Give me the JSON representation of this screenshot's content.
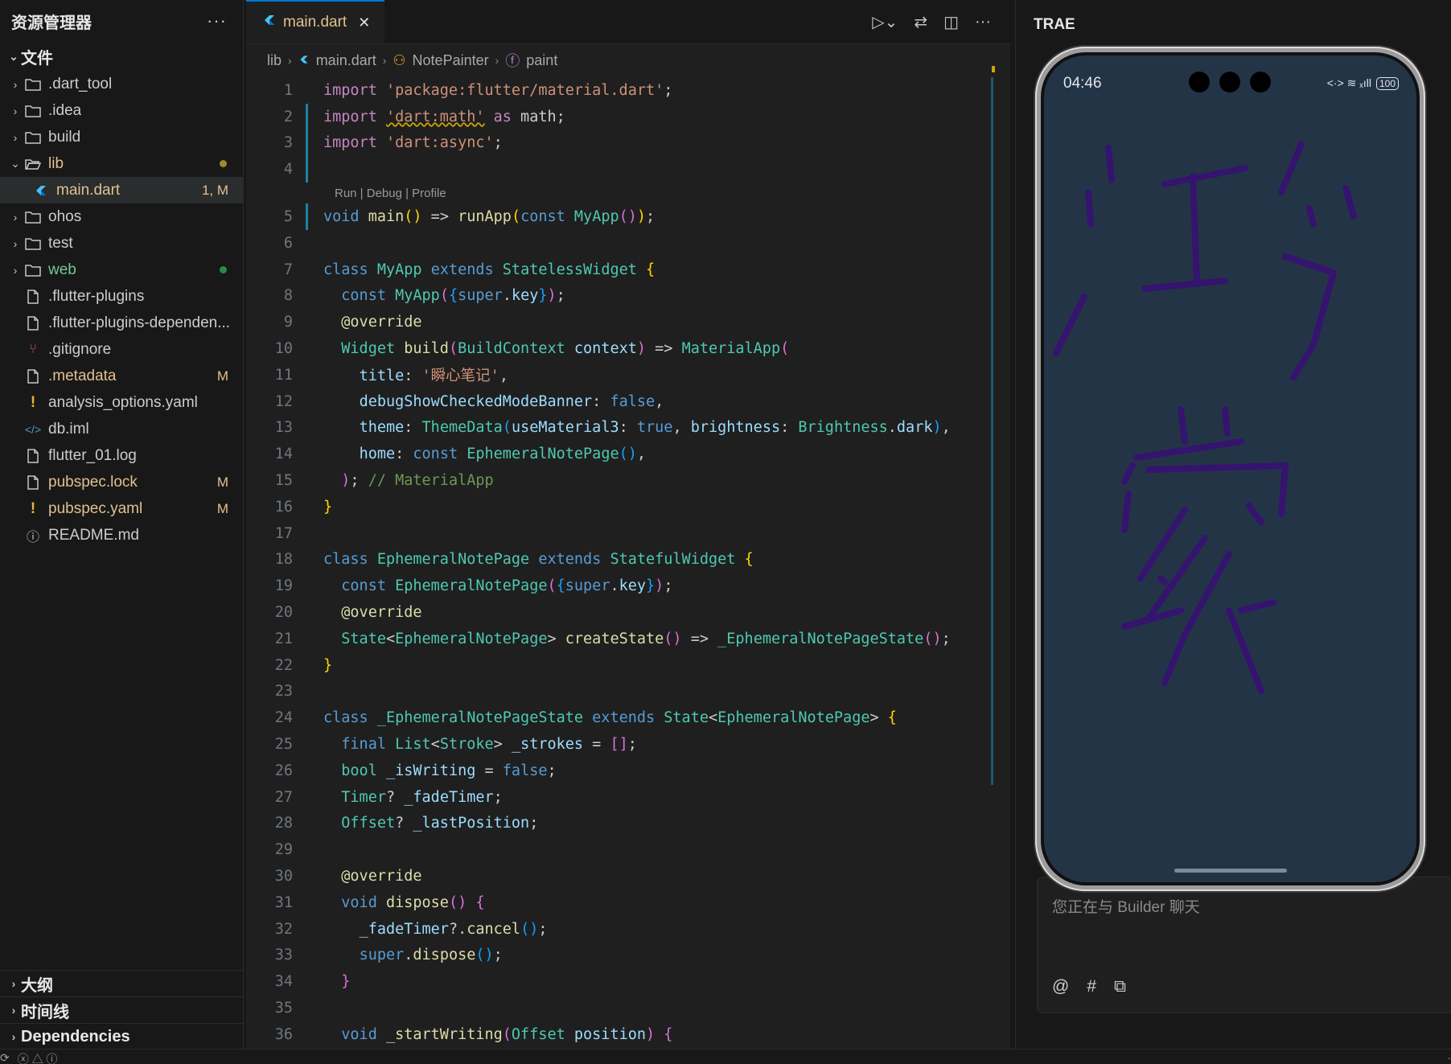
{
  "explorer": {
    "title": "资源管理器",
    "more": "···",
    "section": "文件",
    "items": [
      {
        "label": ".dart_tool",
        "kind": "folder",
        "open": false,
        "color": "#cccccc",
        "badge": "",
        "dot": ""
      },
      {
        "label": ".idea",
        "kind": "folder",
        "open": false,
        "color": "#cccccc",
        "badge": "",
        "dot": ""
      },
      {
        "label": "build",
        "kind": "folder",
        "open": false,
        "color": "#cccccc",
        "badge": "",
        "dot": ""
      },
      {
        "label": "lib",
        "kind": "folder",
        "open": true,
        "color": "#e2c08d",
        "badge": "",
        "dot": "#9b8b2b"
      },
      {
        "label": "main.dart",
        "kind": "dart",
        "open": false,
        "color": "#e2c08d",
        "badge": "1, M",
        "badge_color": "#e2c08d",
        "dot": "",
        "child": true,
        "selected": true
      },
      {
        "label": "ohos",
        "kind": "folder",
        "open": false,
        "color": "#cccccc",
        "badge": "",
        "dot": ""
      },
      {
        "label": "test",
        "kind": "folder",
        "open": false,
        "color": "#cccccc",
        "badge": "",
        "dot": ""
      },
      {
        "label": "web",
        "kind": "folder",
        "open": false,
        "color": "#73c991",
        "badge": "",
        "dot": "#2b8a4a"
      },
      {
        "label": ".flutter-plugins",
        "kind": "file",
        "color": "#cccccc",
        "badge": "",
        "dot": ""
      },
      {
        "label": ".flutter-plugins-dependen...",
        "kind": "file",
        "color": "#cccccc",
        "badge": "",
        "dot": ""
      },
      {
        "label": ".gitignore",
        "kind": "git",
        "color": "#cccccc",
        "badge": "",
        "dot": ""
      },
      {
        "label": ".metadata",
        "kind": "file",
        "color": "#e2c08d",
        "badge": "M",
        "badge_color": "#e2c08d",
        "dot": ""
      },
      {
        "label": "analysis_options.yaml",
        "kind": "yaml",
        "color": "#cccccc",
        "badge": "",
        "dot": ""
      },
      {
        "label": "db.iml",
        "kind": "xml",
        "color": "#cccccc",
        "badge": "",
        "dot": ""
      },
      {
        "label": "flutter_01.log",
        "kind": "file",
        "color": "#cccccc",
        "badge": "",
        "dot": ""
      },
      {
        "label": "pubspec.lock",
        "kind": "file",
        "color": "#e2c08d",
        "badge": "M",
        "badge_color": "#e2c08d",
        "dot": ""
      },
      {
        "label": "pubspec.yaml",
        "kind": "yaml",
        "color": "#e2c08d",
        "badge": "M",
        "badge_color": "#e2c08d",
        "dot": ""
      },
      {
        "label": "README.md",
        "kind": "info",
        "color": "#cccccc",
        "badge": "",
        "dot": ""
      }
    ],
    "bottom_sections": [
      "大纲",
      "时间线",
      "Dependencies"
    ]
  },
  "editor": {
    "tab_label": "main.dart",
    "breadcrumb": [
      "lib",
      "main.dart",
      "NotePainter",
      "paint"
    ],
    "codelens": "Run | Debug | Profile",
    "lines": [
      {
        "n": "1",
        "html": "<span class='k'>import</span> <span class='s'>'package:flutter/material.dart'</span>;"
      },
      {
        "n": "2",
        "html": "<span class='k'>import</span> <span class='s' style='text-decoration:underline wavy #cca700'>'dart:math'</span> <span class='k'>as</span> math;"
      },
      {
        "n": "3",
        "html": "<span class='k'>import</span> <span class='s'>'dart:async'</span>;"
      },
      {
        "n": "4",
        "html": ""
      },
      {
        "n": "5",
        "html": "<span class='kw'>void</span> <span class='fn'>main</span><span class='b1'>()</span> => <span class='fn'>runApp</span><span class='b1'>(</span><span class='kw'>const</span> <span class='ty'>MyApp</span><span class='b2'>()</span><span class='b1'>)</span>;",
        "lens": true
      },
      {
        "n": "6",
        "html": ""
      },
      {
        "n": "7",
        "html": "<span class='kw'>class</span> <span class='ty'>MyApp</span> <span class='kw'>extends</span> <span class='ty'>StatelessWidget</span> <span class='b1'>{</span>"
      },
      {
        "n": "8",
        "html": "  <span class='kw'>const</span> <span class='ty'>MyApp</span><span class='b2'>(</span><span class='b3'>{</span><span class='kw'>super</span>.<span class='v'>key</span><span class='b3'>}</span><span class='b2'>)</span>;"
      },
      {
        "n": "9",
        "html": "  <span class='fn'>@override</span>"
      },
      {
        "n": "10",
        "html": "  <span class='ty'>Widget</span> <span class='fn'>build</span><span class='b2'>(</span><span class='ty'>BuildContext</span> <span class='v'>context</span><span class='b2'>)</span> => <span class='ty'>MaterialApp</span><span class='b2'>(</span>"
      },
      {
        "n": "11",
        "html": "    <span class='pr'>title</span>: <span class='s'>'瞬心笔记'</span>,"
      },
      {
        "n": "12",
        "html": "    <span class='pr'>debugShowCheckedModeBanner</span>: <span class='kw'>false</span>,"
      },
      {
        "n": "13",
        "html": "    <span class='pr'>theme</span>: <span class='ty'>ThemeData</span><span class='b3'>(</span><span class='pr'>useMaterial3</span>: <span class='kw'>true</span>, <span class='pr'>brightness</span>: <span class='ty'>Brightness</span>.<span class='v'>dark</span><span class='b3'>)</span>,"
      },
      {
        "n": "14",
        "html": "    <span class='pr'>home</span>: <span class='kw'>const</span> <span class='ty'>EphemeralNotePage</span><span class='b3'>()</span>,"
      },
      {
        "n": "15",
        "html": "  <span class='b2'>)</span>; <span class='cm'>// MaterialApp</span>"
      },
      {
        "n": "16",
        "html": "<span class='b1'>}</span>"
      },
      {
        "n": "17",
        "html": ""
      },
      {
        "n": "18",
        "html": "<span class='kw'>class</span> <span class='ty'>EphemeralNotePage</span> <span class='kw'>extends</span> <span class='ty'>StatefulWidget</span> <span class='b1'>{</span>"
      },
      {
        "n": "19",
        "html": "  <span class='kw'>const</span> <span class='ty'>EphemeralNotePage</span><span class='b2'>(</span><span class='b3'>{</span><span class='kw'>super</span>.<span class='v'>key</span><span class='b3'>}</span><span class='b2'>)</span>;"
      },
      {
        "n": "20",
        "html": "  <span class='fn'>@override</span>"
      },
      {
        "n": "21",
        "html": "  <span class='ty'>State</span>&lt;<span class='ty'>EphemeralNotePage</span>&gt; <span class='fn'>createState</span><span class='b2'>()</span> => <span class='ty'>_EphemeralNotePageState</span><span class='b2'>()</span>;"
      },
      {
        "n": "22",
        "html": "<span class='b1'>}</span>"
      },
      {
        "n": "23",
        "html": ""
      },
      {
        "n": "24",
        "html": "<span class='kw'>class</span> <span class='ty'>_EphemeralNotePageState</span> <span class='kw'>extends</span> <span class='ty'>State</span>&lt;<span class='ty'>EphemeralNotePage</span>&gt; <span class='b1'>{</span>"
      },
      {
        "n": "25",
        "html": "  <span class='kw'>final</span> <span class='ty'>List</span>&lt;<span class='ty'>Stroke</span>&gt; <span class='v'>_strokes</span> = <span class='b2'>[]</span>;"
      },
      {
        "n": "26",
        "html": "  <span class='ty'>bool</span> <span class='v'>_isWriting</span> = <span class='kw'>false</span>;"
      },
      {
        "n": "27",
        "html": "  <span class='ty'>Timer</span>? <span class='v'>_fadeTimer</span>;"
      },
      {
        "n": "28",
        "html": "  <span class='ty'>Offset</span>? <span class='v'>_lastPosition</span>;"
      },
      {
        "n": "29",
        "html": ""
      },
      {
        "n": "30",
        "html": "  <span class='fn'>@override</span>"
      },
      {
        "n": "31",
        "html": "  <span class='kw'>void</span> <span class='fn'>dispose</span><span class='b2'>()</span> <span class='b2'>{</span>"
      },
      {
        "n": "32",
        "html": "    <span class='v'>_fadeTimer</span>?.<span class='fn'>cancel</span><span class='b3'>()</span>;"
      },
      {
        "n": "33",
        "html": "    <span class='kw'>super</span>.<span class='fn'>dispose</span><span class='b3'>()</span>;"
      },
      {
        "n": "34",
        "html": "  <span class='b2'>}</span>"
      },
      {
        "n": "35",
        "html": ""
      },
      {
        "n": "36",
        "html": "  <span class='kw'>void</span> <span class='fn'>_startWriting</span><span class='b2'>(</span><span class='ty'>Offset</span> <span class='v'>position</span><span class='b2'>)</span> <span class='b2'>{</span>"
      }
    ]
  },
  "right_panel": {
    "title": "TRAE",
    "chat_placeholder": "您正在与 Builder 聊天",
    "tools": [
      "@",
      "#",
      "⧉"
    ]
  },
  "phone": {
    "time": "04:46",
    "battery": "100",
    "signal": "<·> ≋ ₓıll"
  },
  "colors": {
    "accent": "#0078d4",
    "modified": "#e2c08d",
    "untracked": "#73c991",
    "stroke": "#3a1a7a",
    "phone_bg": "#243447"
  }
}
